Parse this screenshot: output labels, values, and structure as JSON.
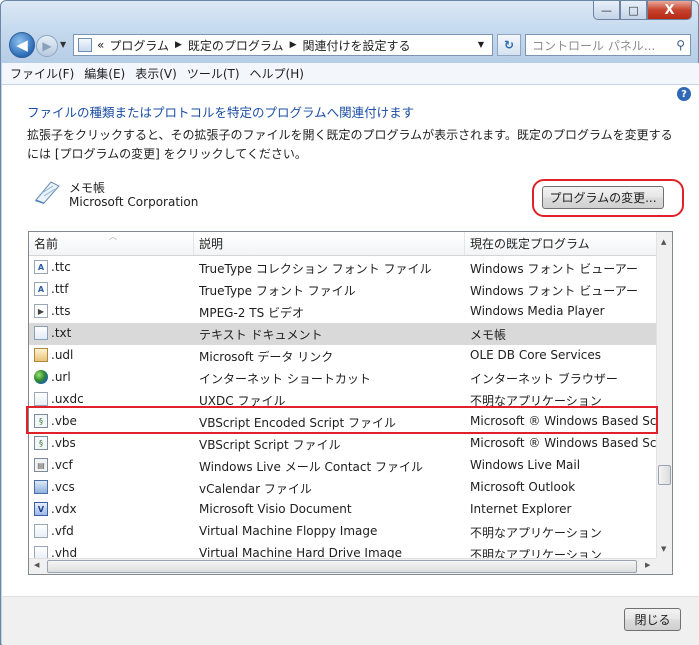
{
  "window": {
    "minimize": "—",
    "maximize": "□",
    "close": "X"
  },
  "navigation": {
    "back": "◀",
    "forward": "▶",
    "breadcrumb": [
      "«",
      "プログラム",
      "既定のプログラム",
      "関連付けを設定する"
    ],
    "search_placeholder": "コントロール パネル..."
  },
  "menu": {
    "items": [
      "ファイル(F)",
      "編集(E)",
      "表示(V)",
      "ツール(T)",
      "ヘルプ(H)"
    ]
  },
  "main": {
    "heading": "ファイルの種類またはプロトコルを特定のプログラムへ関連付けます",
    "description": "拡張子をクリックすると、その拡張子のファイルを開く既定のプログラムが表示されます。既定のプログラムを変更するには [プログラムの変更] をクリックしてください。",
    "program_name": "メモ帳",
    "program_company": "Microsoft Corporation",
    "change_button": "プログラムの変更..."
  },
  "list": {
    "columns": [
      "名前",
      "説明",
      "現在の既定プログラム"
    ],
    "rows": [
      {
        "icon": "font",
        "name": ".ttc",
        "description": "TrueType コレクション フォント ファイル",
        "program": "Windows フォント ビューアー"
      },
      {
        "icon": "font",
        "name": ".ttf",
        "description": "TrueType フォント ファイル",
        "program": "Windows フォント ビューアー"
      },
      {
        "icon": "media",
        "name": ".tts",
        "description": "MPEG-2 TS ビデオ",
        "program": "Windows Media Player"
      },
      {
        "icon": "txt",
        "name": ".txt",
        "description": "テキスト ドキュメント",
        "program": "メモ帳",
        "selected": true
      },
      {
        "icon": "udl",
        "name": ".udl",
        "description": "Microsoft データ リンク",
        "program": "OLE DB Core Services"
      },
      {
        "icon": "globe",
        "name": ".url",
        "description": "インターネット ショートカット",
        "program": "インターネット ブラウザー"
      },
      {
        "icon": "doc",
        "name": ".uxdc",
        "description": "UXDC ファイル",
        "program": "不明なアプリケーション"
      },
      {
        "icon": "script",
        "name": ".vbe",
        "description": "VBScript Encoded Script ファイル",
        "program": "Microsoft ® Windows Based Scri"
      },
      {
        "icon": "script",
        "name": ".vbs",
        "description": "VBScript Script ファイル",
        "program": "Microsoft ® Windows Based Scri"
      },
      {
        "icon": "card",
        "name": ".vcf",
        "description": "Windows Live メール Contact ファイル",
        "program": "Windows Live Mail"
      },
      {
        "icon": "cal",
        "name": ".vcs",
        "description": "vCalendar ファイル",
        "program": "Microsoft Outlook"
      },
      {
        "icon": "visio",
        "name": ".vdx",
        "description": "Microsoft Visio Document",
        "program": "Internet Explorer"
      },
      {
        "icon": "doc",
        "name": ".vfd",
        "description": "Virtual Machine Floppy Image",
        "program": "不明なアプリケーション"
      },
      {
        "icon": "doc",
        "name": ".vhd",
        "description": "Virtual Machine Hard Drive Image",
        "program": "不明なアプリケーション"
      }
    ]
  },
  "footer": {
    "close_button": "閉じる"
  },
  "colors": {
    "heading": "#1c4ea5",
    "highlight": "#e0202a",
    "selected_row": "#d9d9d9"
  }
}
